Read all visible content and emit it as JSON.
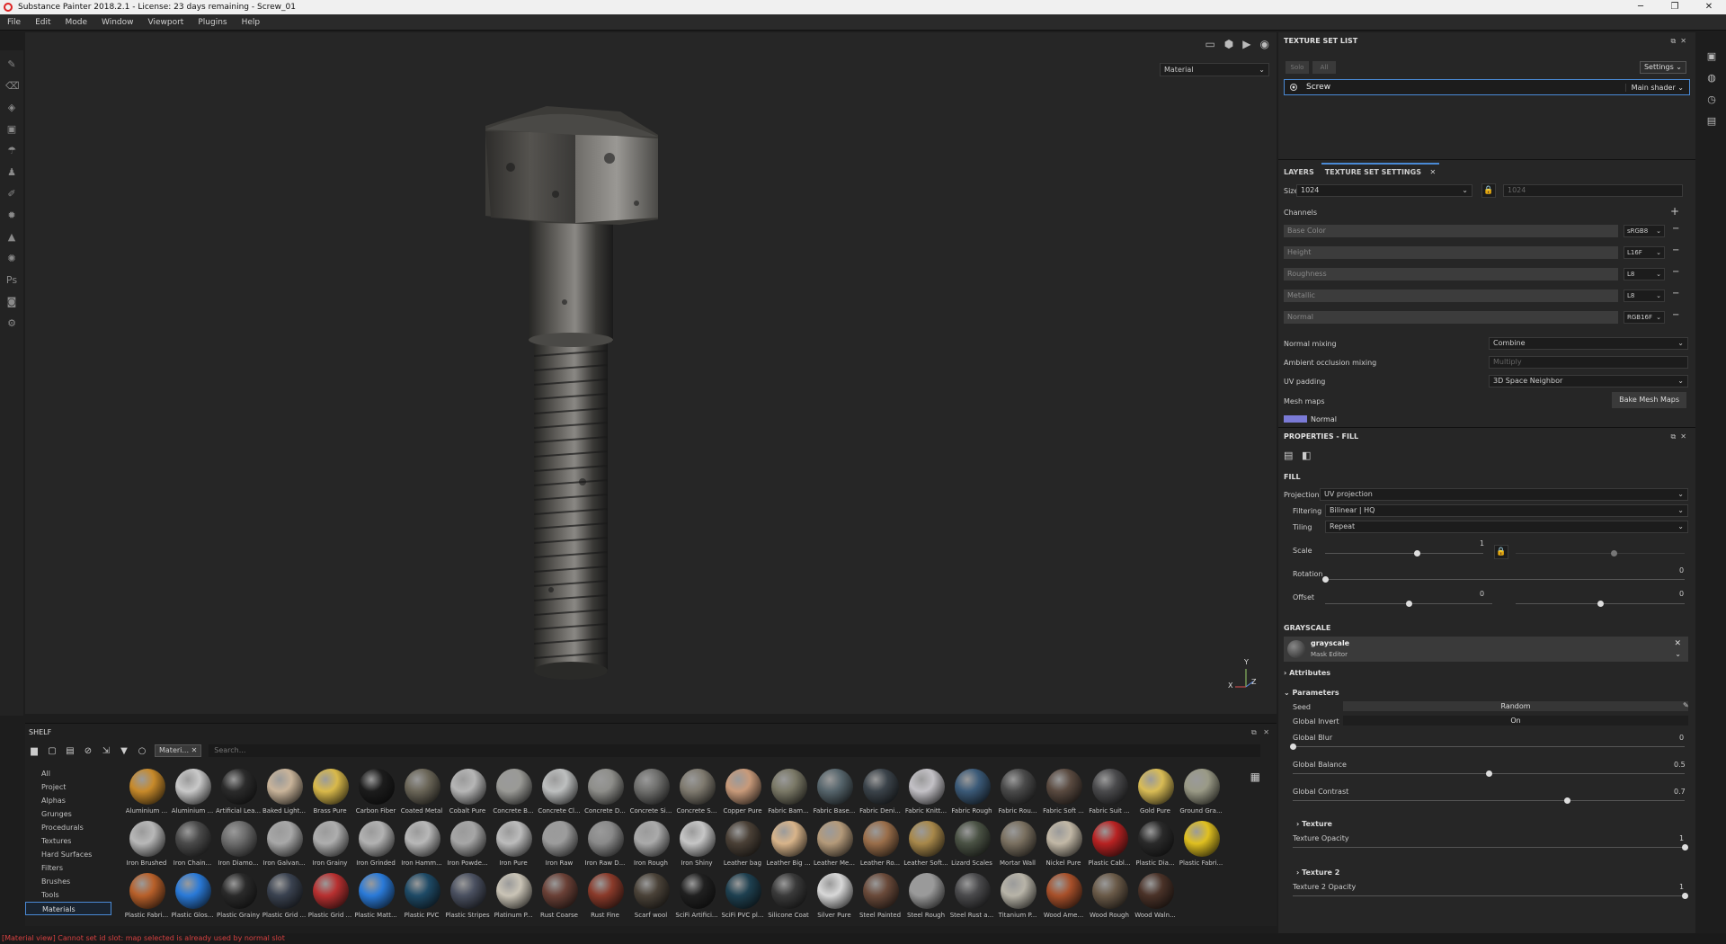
{
  "titlebar": {
    "title": "Substance Painter 2018.2.1 - License: 23 days remaining - Screw_01",
    "minimize": "─",
    "maximize": "❐",
    "close": "✕"
  },
  "menu": [
    "File",
    "Edit",
    "Mode",
    "Window",
    "Viewport",
    "Plugins",
    "Help"
  ],
  "viewport": {
    "display_select": "Material",
    "axis_y": "Y",
    "axis_x": "X",
    "axis_z": "Z"
  },
  "texture_set_list": {
    "title": "TEXTURE SET LIST",
    "solo": "Solo",
    "all": "All",
    "settings": "Settings",
    "set_name": "Screw",
    "shader": "Main shader"
  },
  "texture_set_settings": {
    "tab_layers": "LAYERS",
    "tab_settings": "TEXTURE SET SETTINGS",
    "size_label": "Size",
    "size_value": "1024",
    "size_locked_value": "1024",
    "channels_label": "Channels",
    "channels": [
      {
        "name": "Base Color",
        "format": "sRGB8"
      },
      {
        "name": "Height",
        "format": "L16F"
      },
      {
        "name": "Roughness",
        "format": "L8"
      },
      {
        "name": "Metallic",
        "format": "L8"
      },
      {
        "name": "Normal",
        "format": "RGB16F"
      }
    ],
    "normal_mixing_label": "Normal mixing",
    "normal_mixing_value": "Combine",
    "ao_mixing_label": "Ambient occlusion mixing",
    "ao_mixing_value": "Multiply",
    "uv_padding_label": "UV padding",
    "uv_padding_value": "3D Space Neighbor",
    "mesh_maps_label": "Mesh maps",
    "bake_button": "Bake Mesh Maps",
    "mesh_map_first": "Normal"
  },
  "properties": {
    "title": "PROPERTIES - FILL",
    "fill_label": "FILL",
    "projection_label": "Projection",
    "projection_value": "UV projection",
    "filtering_label": "Filtering",
    "filtering_value": "Bilinear | HQ",
    "tiling_label": "Tiling",
    "tiling_value": "Repeat",
    "scale_label": "Scale",
    "scale_value": "1",
    "rotation_label": "Rotation",
    "rotation_value": "0",
    "offset_label": "Offset",
    "offset_u": "0",
    "offset_v": "0",
    "grayscale_label": "GRAYSCALE",
    "gs_name": "grayscale",
    "gs_sub": "Mask Editor",
    "attributes": "Attributes",
    "parameters": "Parameters",
    "seed_label": "Seed",
    "seed_value": "Random",
    "invert_label": "Global Invert",
    "invert_value": "On",
    "blur_label": "Global Blur",
    "blur_value": "0",
    "balance_label": "Global Balance",
    "balance_value": "0.5",
    "contrast_label": "Global Contrast",
    "contrast_value": "0.7",
    "texture_label": "Texture",
    "tex_opacity_label": "Texture Opacity",
    "tex_opacity_value": "1",
    "texture2_label": "Texture 2",
    "tex2_opacity_label": "Texture 2 Opacity",
    "tex2_opacity_value": "1",
    "sliders": {
      "scale_level": 0.58,
      "scale_v_level": 0.58,
      "rotation_level": 0.0,
      "offset_u_level": 0.5,
      "offset_v_level": 0.5,
      "blur_level": 0.0,
      "balance_level": 0.5,
      "contrast_level": 0.7,
      "tex_opacity_level": 1.0,
      "tex2_opacity_level": 1.0
    }
  },
  "shelf": {
    "title": "SHELF",
    "filter_tag": "Materi...",
    "search_placeholder": "Search...",
    "categories": [
      "All",
      "Project",
      "Alphas",
      "Grunges",
      "Procedurals",
      "Textures",
      "Hard Surfaces",
      "Filters",
      "Brushes",
      "Tools",
      "Materials"
    ],
    "selected_category": "Materials",
    "materials": [
      {
        "name": "Aluminium ...",
        "color": "#c88a2a"
      },
      {
        "name": "Aluminium ...",
        "color": "#c9c9c9"
      },
      {
        "name": "Artificial Lea...",
        "color": "#2b2b2b"
      },
      {
        "name": "Baked Light...",
        "color": "#c9b49a"
      },
      {
        "name": "Brass Pure",
        "color": "#d9b94a"
      },
      {
        "name": "Carbon Fiber",
        "color": "#1c1c1c"
      },
      {
        "name": "Coated Metal",
        "color": "#6b6658"
      },
      {
        "name": "Cobalt Pure",
        "color": "#b6b6b6"
      },
      {
        "name": "Concrete B...",
        "color": "#9a9a96"
      },
      {
        "name": "Concrete Cl...",
        "color": "#bdbfbf"
      },
      {
        "name": "Concrete D...",
        "color": "#8e8e8a"
      },
      {
        "name": "Concrete Si...",
        "color": "#6f6f6d"
      },
      {
        "name": "Concrete S...",
        "color": "#7f7a6f"
      },
      {
        "name": "Copper Pure",
        "color": "#c89a7a"
      },
      {
        "name": "Fabric Bam...",
        "color": "#7a7866"
      },
      {
        "name": "Fabric Base...",
        "color": "#56656c"
      },
      {
        "name": "Fabric Deni...",
        "color": "#3b434a"
      },
      {
        "name": "Fabric Knitt...",
        "color": "#c3c1c6"
      },
      {
        "name": "Fabric Rough",
        "color": "#3b5a78"
      },
      {
        "name": "Fabric Rou...",
        "color": "#4a4a4a"
      },
      {
        "name": "Fabric Soft ...",
        "color": "#5a4a40"
      },
      {
        "name": "Fabric Suit ...",
        "color": "#4a4a4c"
      },
      {
        "name": "Gold Pure",
        "color": "#d9bc55"
      },
      {
        "name": "Ground Gra...",
        "color": "#9a9a86"
      },
      {
        "name": "Iron Brushed",
        "color": "#b8b8b8"
      },
      {
        "name": "Iron Chain...",
        "color": "#4a4a4a"
      },
      {
        "name": "Iron Diamo...",
        "color": "#6c6c6c"
      },
      {
        "name": "Iron Galvan...",
        "color": "#a8a8a8"
      },
      {
        "name": "Iron Grainy",
        "color": "#aeaeae"
      },
      {
        "name": "Iron Grinded",
        "color": "#b2b2b2"
      },
      {
        "name": "Iron Hamm...",
        "color": "#b8b8b8"
      },
      {
        "name": "Iron Powde...",
        "color": "#a6a6a6"
      },
      {
        "name": "Iron Pure",
        "color": "#bcbcbc"
      },
      {
        "name": "Iron Raw",
        "color": "#9c9c9c"
      },
      {
        "name": "Iron Raw D...",
        "color": "#8a8a8a"
      },
      {
        "name": "Iron Rough",
        "color": "#aaaaaa"
      },
      {
        "name": "Iron Shiny",
        "color": "#c6c6c6"
      },
      {
        "name": "Leather bag",
        "color": "#4a4036"
      },
      {
        "name": "Leather Big ...",
        "color": "#d8b48a"
      },
      {
        "name": "Leather Me...",
        "color": "#b49a7a"
      },
      {
        "name": "Leather Ro...",
        "color": "#9a6e4a"
      },
      {
        "name": "Leather Soft...",
        "color": "#a8884a"
      },
      {
        "name": "Lizard Scales",
        "color": "#4a5244"
      },
      {
        "name": "Mortar Wall",
        "color": "#7a7060"
      },
      {
        "name": "Nickel Pure",
        "color": "#c2b8a6"
      },
      {
        "name": "Plastic Cabl...",
        "color": "#b82222"
      },
      {
        "name": "Plastic Dia...",
        "color": "#2a2a2a"
      },
      {
        "name": "Plastic Fabri...",
        "color": "#e0c020"
      },
      {
        "name": "Plastic Fabri...",
        "color": "#b8602a"
      },
      {
        "name": "Plastic Glos...",
        "color": "#2a7ad8"
      },
      {
        "name": "Plastic Grainy",
        "color": "#2a2a2a"
      },
      {
        "name": "Plastic Grid ...",
        "color": "#3a4250"
      },
      {
        "name": "Plastic Grid ...",
        "color": "#b83030"
      },
      {
        "name": "Plastic Matt...",
        "color": "#2a7ad8"
      },
      {
        "name": "Plastic PVC",
        "color": "#1e4a66"
      },
      {
        "name": "Plastic Stripes",
        "color": "#4a5060"
      },
      {
        "name": "Platinum P...",
        "color": "#cac4b6"
      },
      {
        "name": "Rust Coarse",
        "color": "#6a4036"
      },
      {
        "name": "Rust Fine",
        "color": "#8a3a2a"
      },
      {
        "name": "Scarf wool",
        "color": "#4a4238"
      },
      {
        "name": "SciFi Artifici...",
        "color": "#202020"
      },
      {
        "name": "SciFi PVC pl...",
        "color": "#1e4050"
      },
      {
        "name": "Silicone Coat",
        "color": "#3a3a3a"
      },
      {
        "name": "Silver Pure",
        "color": "#d8d8d8"
      },
      {
        "name": "Steel Painted",
        "color": "#6a4a3a"
      },
      {
        "name": "Steel Rough",
        "color": "#9a9a9a"
      },
      {
        "name": "Steel Rust a...",
        "color": "#4a4a4c"
      },
      {
        "name": "Titanium P...",
        "color": "#b8b4a8"
      },
      {
        "name": "Wood Ame...",
        "color": "#a8502a"
      },
      {
        "name": "Wood Rough",
        "color": "#6a5a48"
      },
      {
        "name": "Wood Waln...",
        "color": "#4a3228"
      }
    ]
  },
  "status": "[Material view] Cannot set id slot: map selected is already used by normal slot"
}
